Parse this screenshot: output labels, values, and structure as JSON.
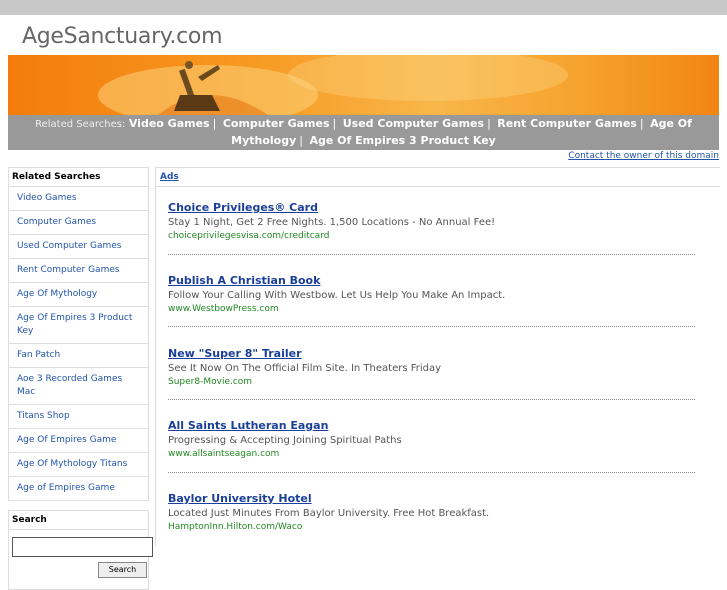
{
  "site": {
    "title": "AgeSanctuary.com"
  },
  "related_bar": {
    "prefix": "Related Searches:",
    "links": [
      "Video Games",
      "Computer Games",
      "Used Computer Games",
      "Rent Computer Games",
      "Age Of Mythology",
      "Age Of Empires 3 Product Key"
    ],
    "separator": "|"
  },
  "contact": {
    "label": "Contact the owner of this domain"
  },
  "sidebar": {
    "heading": "Related Searches",
    "items": [
      {
        "label": "Video Games"
      },
      {
        "label": "Computer Games"
      },
      {
        "label": "Used Computer Games"
      },
      {
        "label": "Rent Computer Games"
      },
      {
        "label": "Age Of Mythology"
      },
      {
        "label": "Age Of Empires 3 Product Key"
      },
      {
        "label": "Fan Patch"
      },
      {
        "label": "Aoe 3 Recorded Games Mac"
      },
      {
        "label": "Titans Shop"
      },
      {
        "label": "Age Of Empires Game"
      },
      {
        "label": "Age Of Mythology Titans"
      },
      {
        "label": "Age of Empires Game"
      }
    ],
    "search": {
      "heading": "Search",
      "value": "",
      "button_label": "Search"
    }
  },
  "main": {
    "ads_label": "Ads",
    "ads": [
      {
        "title": "Choice Privileges® Card",
        "desc": "Stay 1 Night, Get 2 Free Nights. 1,500 Locations - No Annual Fee!",
        "url": "choiceprivilegesvisa.com/creditcard"
      },
      {
        "title": "Publish A Christian Book",
        "desc": "Follow Your Calling With Westbow. Let Us Help You Make An Impact.",
        "url": "www.WestbowPress.com"
      },
      {
        "title": "New \"Super 8\" Trailer",
        "desc": "See It Now On The Official Film Site. In Theaters Friday",
        "url": "Super8-Movie.com"
      },
      {
        "title": "All Saints Lutheran Eagan",
        "desc": "Progressing & Accepting Joining Spiritual Paths",
        "url": "www.allsaintseagan.com"
      },
      {
        "title": "Baylor University Hotel",
        "desc": "Located Just Minutes From Baylor University. Free Hot Breakfast.",
        "url": "HamptonInn.Hilton.com/Waco"
      }
    ]
  },
  "colors": {
    "link": "#2255aa",
    "ad_title": "#1a3f9a",
    "ad_url": "#228822",
    "banner": "#f79a22",
    "bar": "#999999"
  }
}
